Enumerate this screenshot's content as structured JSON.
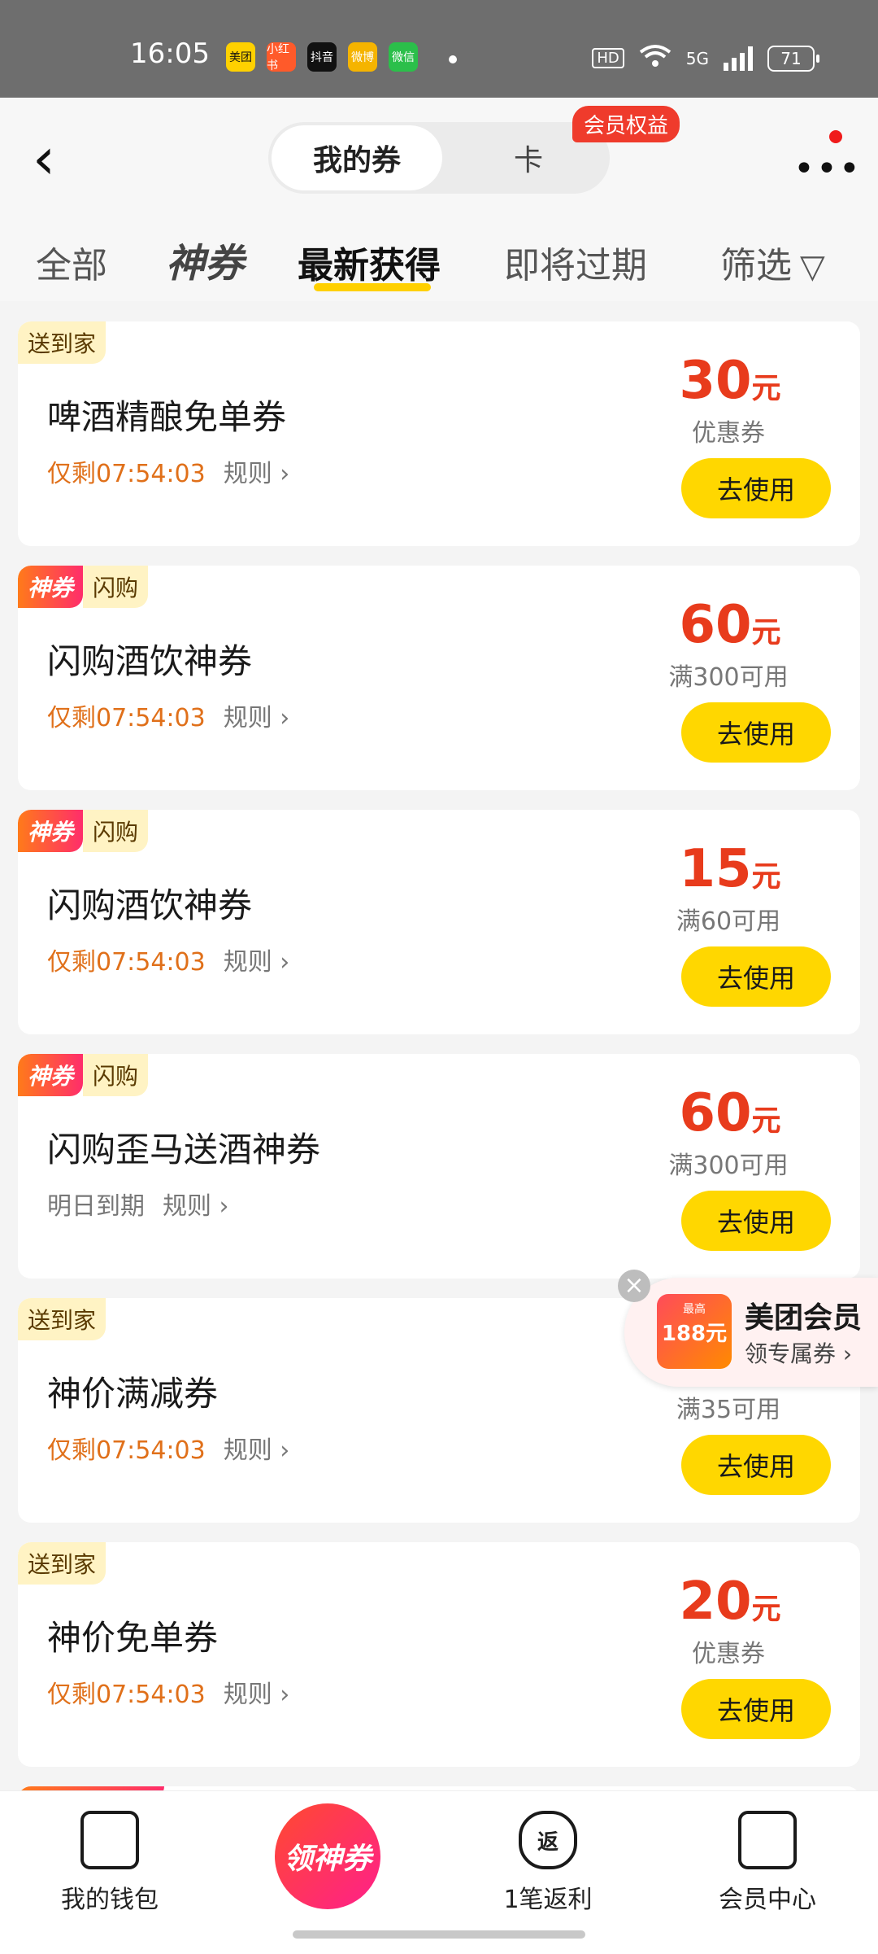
{
  "status_bar": {
    "time": "16:05",
    "apps": [
      "美团",
      "小红书",
      "抖音",
      "微博",
      "微信"
    ],
    "hd": "HD",
    "network": "5G",
    "battery": "71"
  },
  "header": {
    "segment_active": "我的券",
    "segment_other": "卡",
    "member_badge": "会员权益"
  },
  "tabs": {
    "all": "全部",
    "shen": "神券",
    "latest": "最新获得",
    "expiring": "即将过期",
    "filter": "筛选"
  },
  "coupons": [
    {
      "tags": [
        "送到家"
      ],
      "title": "啤酒精酿免单券",
      "expire": "仅剩07:54:03",
      "rule": "规则",
      "amount": "30",
      "unit": "元",
      "condition": "优惠券",
      "button": "去使用"
    },
    {
      "tags": [
        "神券",
        "闪购"
      ],
      "title": "闪购酒饮神券",
      "expire": "仅剩07:54:03",
      "rule": "规则",
      "amount": "60",
      "unit": "元",
      "condition": "满300可用",
      "button": "去使用"
    },
    {
      "tags": [
        "神券",
        "闪购"
      ],
      "title": "闪购酒饮神券",
      "expire": "仅剩07:54:03",
      "rule": "规则",
      "amount": "15",
      "unit": "元",
      "condition": "满60可用",
      "button": "去使用"
    },
    {
      "tags": [
        "神券",
        "闪购"
      ],
      "title": "闪购歪马送酒神券",
      "expire": "明日到期",
      "rule": "规则",
      "amount": "60",
      "unit": "元",
      "condition": "满300可用",
      "button": "去使用"
    },
    {
      "tags": [
        "送到家"
      ],
      "title": "神价满减券",
      "expire": "仅剩07:54:03",
      "rule": "规则",
      "amount": "",
      "unit": "",
      "condition": "满35可用",
      "button": "去使用"
    },
    {
      "tags": [
        "送到家"
      ],
      "title": "神价免单券",
      "expire": "仅剩07:54:03",
      "rule": "规则",
      "amount": "20",
      "unit": "元",
      "condition": "优惠券",
      "button": "去使用"
    }
  ],
  "float_ad": {
    "icon_small": "最高",
    "icon_big": "188元",
    "title": "美团会员",
    "subtitle": "领专属券 ›"
  },
  "bottom_nav": {
    "wallet": "我的钱包",
    "center": "领神券",
    "rebate_icon": "返",
    "rebate": "1笔返利",
    "member": "会员中心"
  },
  "colors": {
    "accent_yellow": "#ffd700",
    "price_red": "#e83b1c",
    "countdown_orange": "#e0701a"
  }
}
